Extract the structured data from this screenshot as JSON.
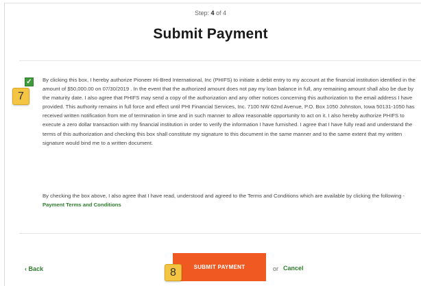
{
  "step": {
    "prefix": "Step:",
    "current": "4",
    "suffix": "of 4"
  },
  "title": "Submit Payment",
  "checkbox": {
    "checked": true,
    "mark": "✓"
  },
  "callouts": {
    "checkbox_number": "7",
    "submit_number": "8"
  },
  "terms_text": "By clicking this box, I hereby authorize Pioneer Hi-Bred International, Inc (PHIFS) to initiate a debit entry to my account at the financial institution identified in the amount of $50,000.00 on 07/30/2019 . In the event that the authorized amount does not pay my loan balance in full, any remaining amount shall also be due by the maturity date. I also agree that PHIFS may send a copy of the authorization and any other notices concerning this authorization to the email address I have provided. This authority remains in full force and effect until PHI Financial Services, Inc. 7100 NW 62nd Avenue, P.O. Box 1050 Johnston, Iowa 50131-1050 has received written notification from me of termination in time and in such manner to allow reasonable opportunity to act on it. I also hereby authorize PHIFS to execute a zero dollar transaction with my financial institution in order to verify the information I have furnished. I agree that I have fully read and understand the terms of this authorization and checking this box shall constitute my signature to this document in the same manner and to the same extent that my written signature would bind me to a written document.",
  "agree_text": "By checking the box above, I also agree that I have read, understood and agreed to the Terms and Conditions which are available by clicking the following - ",
  "terms_link": "Payment Terms and Conditions",
  "actions": {
    "back": "‹ Back",
    "submit": "SUBMIT PAYMENT",
    "or": "or",
    "cancel": "Cancel"
  },
  "colors": {
    "accent_green": "#3e9a3a",
    "link_green": "#2e7d2e",
    "submit_orange": "#f05a22",
    "callout_yellow": "#f4c542"
  }
}
